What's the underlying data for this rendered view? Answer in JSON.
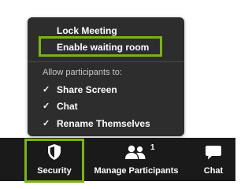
{
  "menu": {
    "lock_meeting": "Lock Meeting",
    "enable_waiting_room": "Enable waiting room",
    "allow_label": "Allow participants to:",
    "permissions": [
      {
        "label": "Share Screen",
        "checked": true
      },
      {
        "label": "Chat",
        "checked": true
      },
      {
        "label": "Rename Themselves",
        "checked": true
      }
    ]
  },
  "toolbar": {
    "security_label": "Security",
    "manage_participants_label": "Manage Participants",
    "participant_count": "1",
    "chat_label": "Chat"
  },
  "colors": {
    "highlight": "#7ab317",
    "menu_bg": "#2d2d2d",
    "toolbar_bg": "#1a1a1a"
  },
  "icons": {
    "security": "shield-icon",
    "participants": "participants-icon",
    "chat": "chat-bubble-icon",
    "check": "check-icon"
  }
}
